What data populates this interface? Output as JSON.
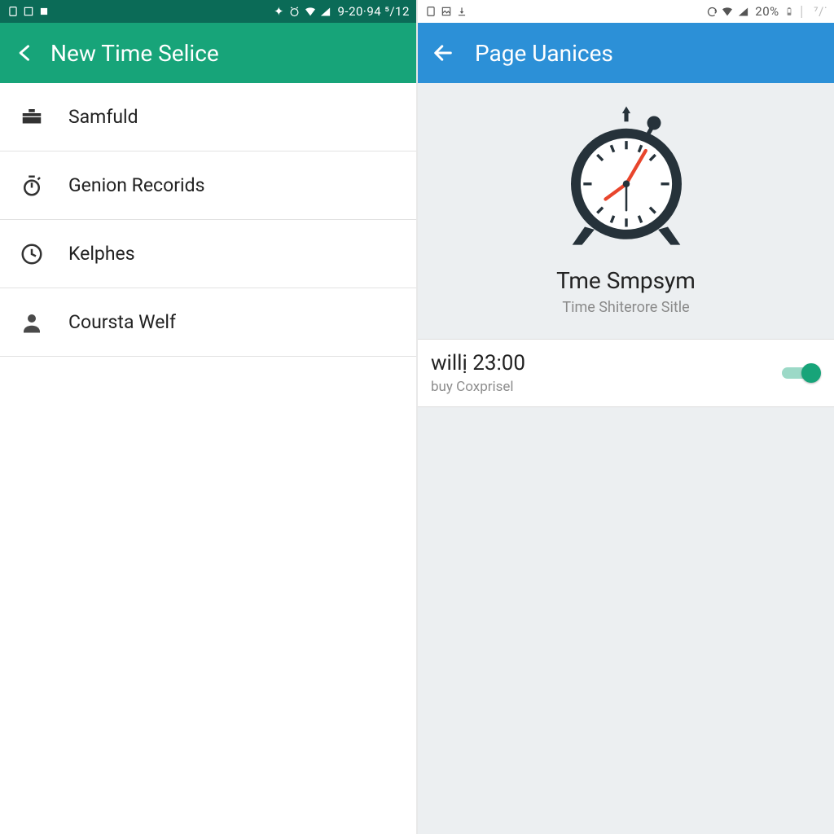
{
  "left": {
    "statusbar": {
      "right_text": "9-20·94 ⁵/12"
    },
    "appbar": {
      "title": "New Time Selice"
    },
    "items": [
      {
        "icon": "briefcase-icon",
        "label": "Samfuld"
      },
      {
        "icon": "stopwatch-icon",
        "label": "Genion Recorids"
      },
      {
        "icon": "clock-icon",
        "label": "Kelphes"
      },
      {
        "icon": "person-icon",
        "label": "Coursta Welf"
      }
    ]
  },
  "right": {
    "statusbar": {
      "battery_text": "20%"
    },
    "appbar": {
      "title": "Page Uanices"
    },
    "hero": {
      "title": "Tme Smpsym",
      "subtitle": "Time Shiterore Sitle"
    },
    "setting": {
      "primary": "willị 23:00",
      "secondary": "buy Coxprisel",
      "enabled": true
    }
  }
}
